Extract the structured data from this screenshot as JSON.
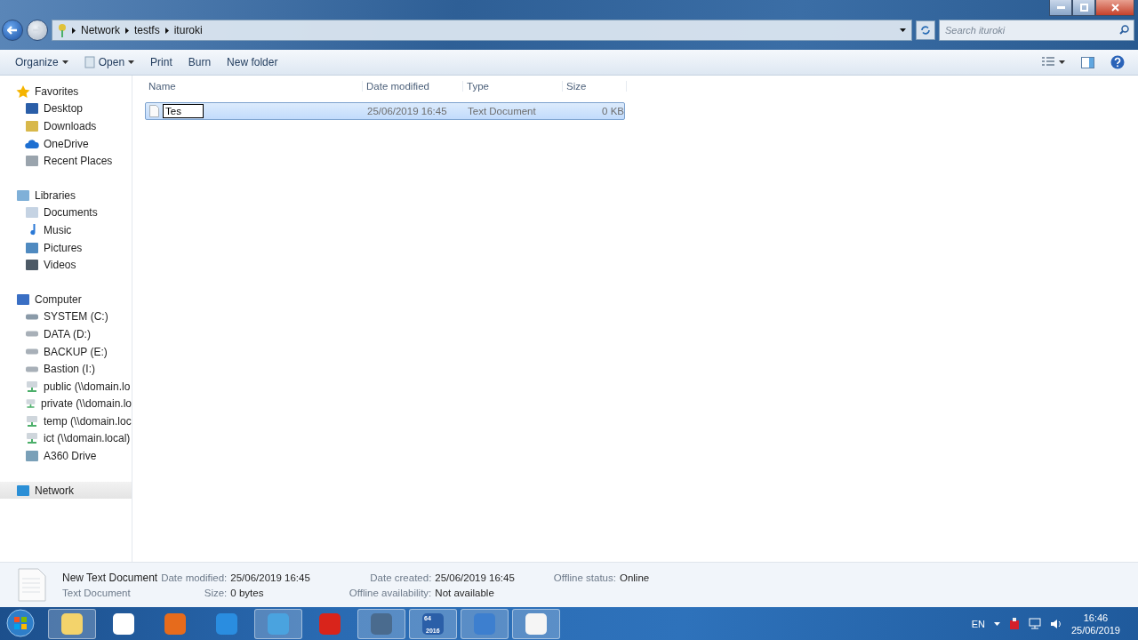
{
  "address_bar": {
    "crumbs": [
      "Network",
      "testfs",
      "ituroki"
    ]
  },
  "search": {
    "placeholder": "Search ituroki"
  },
  "toolbar": {
    "buttons": [
      {
        "label": "Organize",
        "kind": "menu"
      },
      {
        "label": "Open",
        "kind": "open"
      },
      {
        "label": "Print",
        "kind": "plain"
      },
      {
        "label": "Burn",
        "kind": "plain"
      },
      {
        "label": "New folder",
        "kind": "plain"
      }
    ]
  },
  "sidebar": {
    "groups": [
      {
        "label": "Favorites",
        "selected": false,
        "children": [
          {
            "label": "Desktop",
            "selected": false
          },
          {
            "label": "Downloads",
            "selected": false
          },
          {
            "label": "OneDrive",
            "selected": false
          },
          {
            "label": "Recent Places",
            "selected": false
          }
        ]
      },
      {
        "label": "Libraries",
        "selected": false,
        "children": [
          {
            "label": "Documents",
            "selected": false
          },
          {
            "label": "Music",
            "selected": false
          },
          {
            "label": "Pictures",
            "selected": false
          },
          {
            "label": "Videos",
            "selected": false
          }
        ]
      },
      {
        "label": "Computer",
        "selected": false,
        "children": [
          {
            "label": "SYSTEM (C:)",
            "selected": false
          },
          {
            "label": "DATA (D:)",
            "selected": false
          },
          {
            "label": "BACKUP (E:)",
            "selected": false
          },
          {
            "label": "Bastion (I:)",
            "selected": false
          },
          {
            "label": "public (\\\\domain.lo",
            "selected": false
          },
          {
            "label": "private (\\\\domain.lo",
            "selected": false
          },
          {
            "label": "temp (\\\\domain.loc",
            "selected": false
          },
          {
            "label": "ict (\\\\domain.local)",
            "selected": false
          },
          {
            "label": "A360 Drive",
            "selected": false
          }
        ]
      },
      {
        "label": "Network",
        "selected": true
      }
    ]
  },
  "file_list": {
    "columns": [
      "Name",
      "Date modified",
      "Type",
      "Size"
    ],
    "rows": [
      {
        "name": "Tes",
        "renaming": true,
        "selected": true,
        "date_modified": "25/06/2019 16:45",
        "type": "Text Document",
        "size": "0 KB"
      }
    ]
  },
  "details_pane": {
    "name": "New Text Document",
    "type": "Text Document",
    "fields": [
      {
        "label": "Date modified:",
        "value": "25/06/2019 16:45"
      },
      {
        "label": "Date created:",
        "value": "25/06/2019 16:45"
      },
      {
        "label": "Offline status:",
        "value": "Online"
      },
      {
        "label": "Size:",
        "value": "0 bytes"
      },
      {
        "label": "Offline availability:",
        "value": "Not available"
      }
    ]
  },
  "taskbar": {
    "buttons": [
      {
        "open": true
      },
      {
        "open": false
      },
      {
        "open": false
      },
      {
        "open": false
      },
      {
        "open": true
      },
      {
        "open": false
      },
      {
        "open": true
      },
      {
        "open": true,
        "labels": [
          "64",
          "2016"
        ]
      },
      {
        "open": true
      },
      {
        "open": true
      }
    ],
    "language": "EN",
    "time": "16:46",
    "date": "25/06/2019"
  }
}
